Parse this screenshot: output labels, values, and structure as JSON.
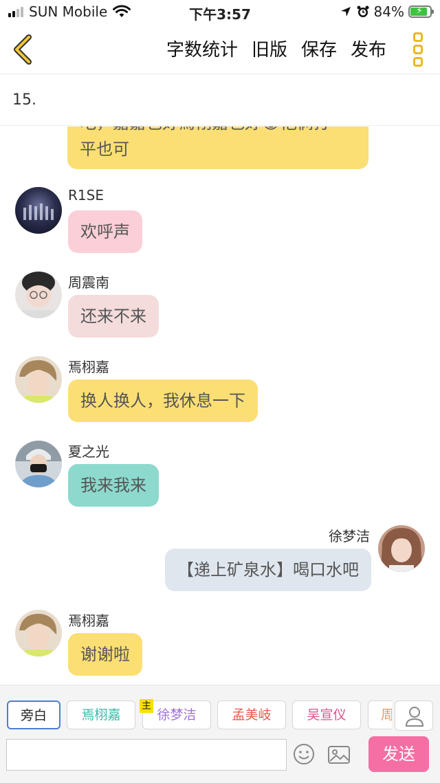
{
  "status_bar": {
    "carrier": "SUN Mobile",
    "time": "下午3:57",
    "battery": "84%"
  },
  "nav": {
    "actions": [
      "字数统计",
      "旧版",
      "保存",
      "发布"
    ],
    "icons": [
      "chevron-left-icon",
      "more-vertical-icon"
    ]
  },
  "chapter": {
    "title": "15."
  },
  "chat": {
    "partial_top": {
      "line1": "吧，嘉嘉也好焉栩嘉也好😂他俩打",
      "line2": "平也可"
    },
    "messages": [
      {
        "sender": "R1SE",
        "text": "欢呼声"
      },
      {
        "sender": "周震南",
        "text": "还来不来"
      },
      {
        "sender": "焉栩嘉",
        "text": "换人换人，我休息一下"
      },
      {
        "sender": "夏之光",
        "text": "我来我来"
      },
      {
        "sender": "徐梦洁",
        "text": "【递上矿泉水】喝口水吧"
      },
      {
        "sender": "焉栩嘉",
        "text": "谢谢啦"
      }
    ]
  },
  "roles": {
    "items": [
      {
        "label": "旁白",
        "color": "#222222"
      },
      {
        "label": "焉栩嘉",
        "color": "#3cb8a8"
      },
      {
        "label": "徐梦洁",
        "color": "#a070d8"
      },
      {
        "label": "孟美岐",
        "color": "#e05a4a"
      },
      {
        "label": "吴宣仪",
        "color": "#e0508a"
      },
      {
        "label": "周",
        "color": "#e8965a"
      }
    ],
    "owner_tag": "主"
  },
  "composer": {
    "input_value": "",
    "send_label": "发送"
  },
  "colors": {
    "accent_yellow": "#e8b820",
    "send_pink": "#f56fa5",
    "selected_role_border": "#4a7fd4"
  }
}
